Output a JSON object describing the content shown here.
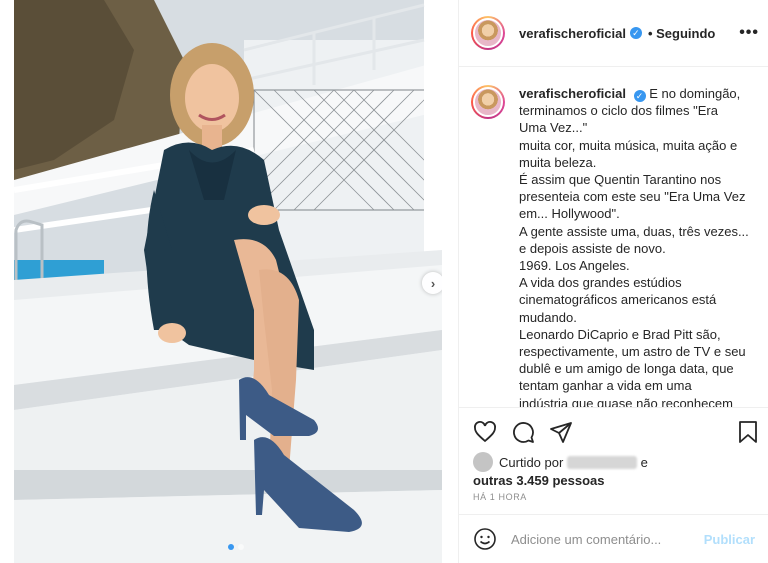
{
  "post": {
    "author": "verafischeroficial",
    "follow_state": "• Seguindo",
    "image_alt": "photo of a woman in a dark green dress and blue heels sitting on white steps by a pool",
    "carousel_dots": 2,
    "carousel_active_index": 0
  },
  "caption": {
    "author": "verafischeroficial",
    "lines": [
      "E no domingão,",
      "terminamos o ciclo dos filmes \"Era",
      "Uma Vez...\"",
      "muita cor, muita música, muita ação e",
      "muita beleza.",
      "É assim que Quentin Tarantino nos",
      "presenteia com este seu \"Era Uma Vez",
      "em... Hollywood\".",
      "A gente assiste uma, duas, três vezes...",
      "e depois assiste de novo.",
      "1969. Los Angeles.",
      "A vida dos grandes estúdios",
      "cinematográficos americanos está",
      "mudando.",
      "Leonardo DiCaprio e Brad Pitt são,",
      "respectivamente, um astro de TV e seu",
      "dublê e um amigo de longa data, que",
      "tentam ganhar a vida em uma",
      "indústria que quase não reconhecem"
    ]
  },
  "likes": {
    "prefix": "Curtido por",
    "suffix": "e",
    "others": "outras 3.459 pessoas"
  },
  "timestamp": "HÁ 1 HORA",
  "comment": {
    "placeholder": "Adicione um comentário...",
    "publish_label": "Publicar"
  },
  "icons": {
    "more": "more-options-icon",
    "like": "heart-icon",
    "comment": "comment-icon",
    "share": "share-icon",
    "save": "bookmark-icon",
    "emoji": "emoji-icon",
    "next": "chevron-right-icon"
  },
  "colors": {
    "verified": "#3897f0",
    "publish_disabled": "#b2dffc",
    "muted_text": "#8e8e8e",
    "dress": "#1f3b4c",
    "shoes": "#3d5b86"
  }
}
